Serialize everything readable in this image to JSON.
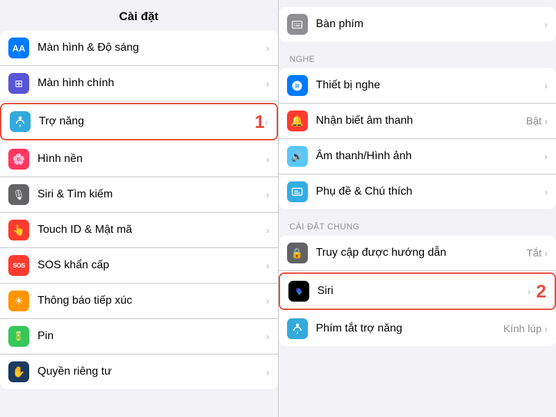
{
  "left_panel": {
    "title": "Cài đặt",
    "items": [
      {
        "id": "man-hinh-do-sang",
        "label": "Màn hình & Độ sáng",
        "icon_text": "AA",
        "icon_color": "icon-blue",
        "highlighted": false
      },
      {
        "id": "man-hinh-chinh",
        "label": "Màn hình chính",
        "icon_emoji": "⊞",
        "icon_color": "icon-purple",
        "highlighted": false
      },
      {
        "id": "tro-nang",
        "label": "Trợ năng",
        "icon_emoji": "♿",
        "icon_color": "icon-blue2",
        "highlighted": true,
        "badge": "1"
      },
      {
        "id": "hinh-nen",
        "label": "Hình nền",
        "icon_emoji": "✿",
        "icon_color": "icon-pink",
        "highlighted": false
      },
      {
        "id": "siri-tim-kiem",
        "label": "Siri & Tìm kiếm",
        "icon_emoji": "🎵",
        "icon_color": "icon-dark",
        "highlighted": false
      },
      {
        "id": "touch-id",
        "label": "Touch ID & Mật mã",
        "icon_emoji": "👆",
        "icon_color": "icon-red",
        "highlighted": false
      },
      {
        "id": "sos",
        "label": "SOS khẩn cấp",
        "icon_emoji": "SOS",
        "icon_color": "icon-sos",
        "highlighted": false
      },
      {
        "id": "thong-bao",
        "label": "Thông báo tiếp xúc",
        "icon_emoji": "✳",
        "icon_color": "icon-orange",
        "highlighted": false
      },
      {
        "id": "pin",
        "label": "Pin",
        "icon_emoji": "▬",
        "icon_color": "icon-green",
        "highlighted": false
      },
      {
        "id": "quyen-rieng-tu",
        "label": "Quyền riêng tư",
        "icon_emoji": "✋",
        "icon_color": "icon-navy",
        "highlighted": false
      }
    ]
  },
  "right_panel": {
    "sections": [
      {
        "id": "top",
        "items": [
          {
            "id": "ban-phim",
            "label": "Bàn phím",
            "icon_emoji": "⌨",
            "icon_color": "icon-gray"
          }
        ]
      },
      {
        "id": "nghe",
        "header": "NGHE",
        "items": [
          {
            "id": "thiet-bi-nghe",
            "label": "Thiết bị nghe",
            "icon_emoji": "👂",
            "icon_color": "icon-blue"
          },
          {
            "id": "nhan-biet-am-thanh",
            "label": "Nhận biết âm thanh",
            "icon_emoji": "🔔",
            "icon_color": "icon-red",
            "value": "Bật"
          },
          {
            "id": "am-thanh-hinh-anh",
            "label": "Âm thanh/Hình ảnh",
            "icon_emoji": "🔊",
            "icon_color": "icon-teal"
          },
          {
            "id": "phu-de",
            "label": "Phụ đề & Chú thích",
            "icon_emoji": "💬",
            "icon_color": "icon-cyan"
          }
        ]
      },
      {
        "id": "cai-dat-chung",
        "header": "CÀI ĐẶT CHUNG",
        "items": [
          {
            "id": "truy-cap",
            "label": "Truy cập được hướng dẫn",
            "icon_emoji": "🔒",
            "icon_color": "icon-dark",
            "value": "Tắt"
          },
          {
            "id": "siri",
            "label": "Siri",
            "icon_emoji": "◉",
            "icon_color": "icon-siri",
            "highlighted": true,
            "badge": "2"
          },
          {
            "id": "phim-tat-tro-nang",
            "label": "Phím tắt trợ năng",
            "icon_emoji": "♿",
            "icon_color": "icon-blue2",
            "value": "Kính lúp"
          }
        ]
      }
    ]
  }
}
